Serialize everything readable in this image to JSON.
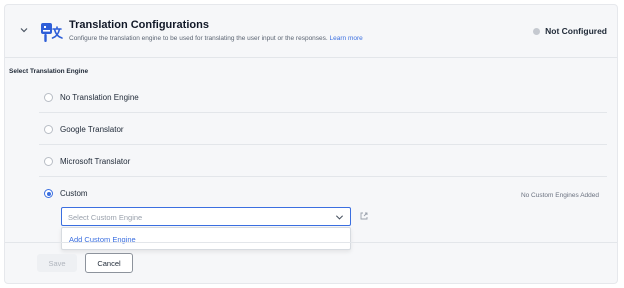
{
  "header": {
    "title": "Translation Configurations",
    "subtitle": "Configure the translation engine to be used for translating the user input or the responses.",
    "learn_more": "Learn more",
    "status": "Not Configured"
  },
  "section_label": "Select Translation Engine",
  "options": [
    {
      "label": "No Translation Engine",
      "selected": false
    },
    {
      "label": "Google Translator",
      "selected": false
    },
    {
      "label": "Microsoft Translator",
      "selected": false
    },
    {
      "label": "Custom",
      "selected": true
    }
  ],
  "custom": {
    "note": "No Custom Engines Added",
    "select_placeholder": "Select Custom Engine",
    "dropdown_item": "Add Custom Engine"
  },
  "buttons": {
    "save": "Save",
    "cancel": "Cancel"
  },
  "colors": {
    "accent": "#3b6fe0",
    "panel_bg": "#f6f7f9",
    "status_dot": "#c5c9d0"
  }
}
